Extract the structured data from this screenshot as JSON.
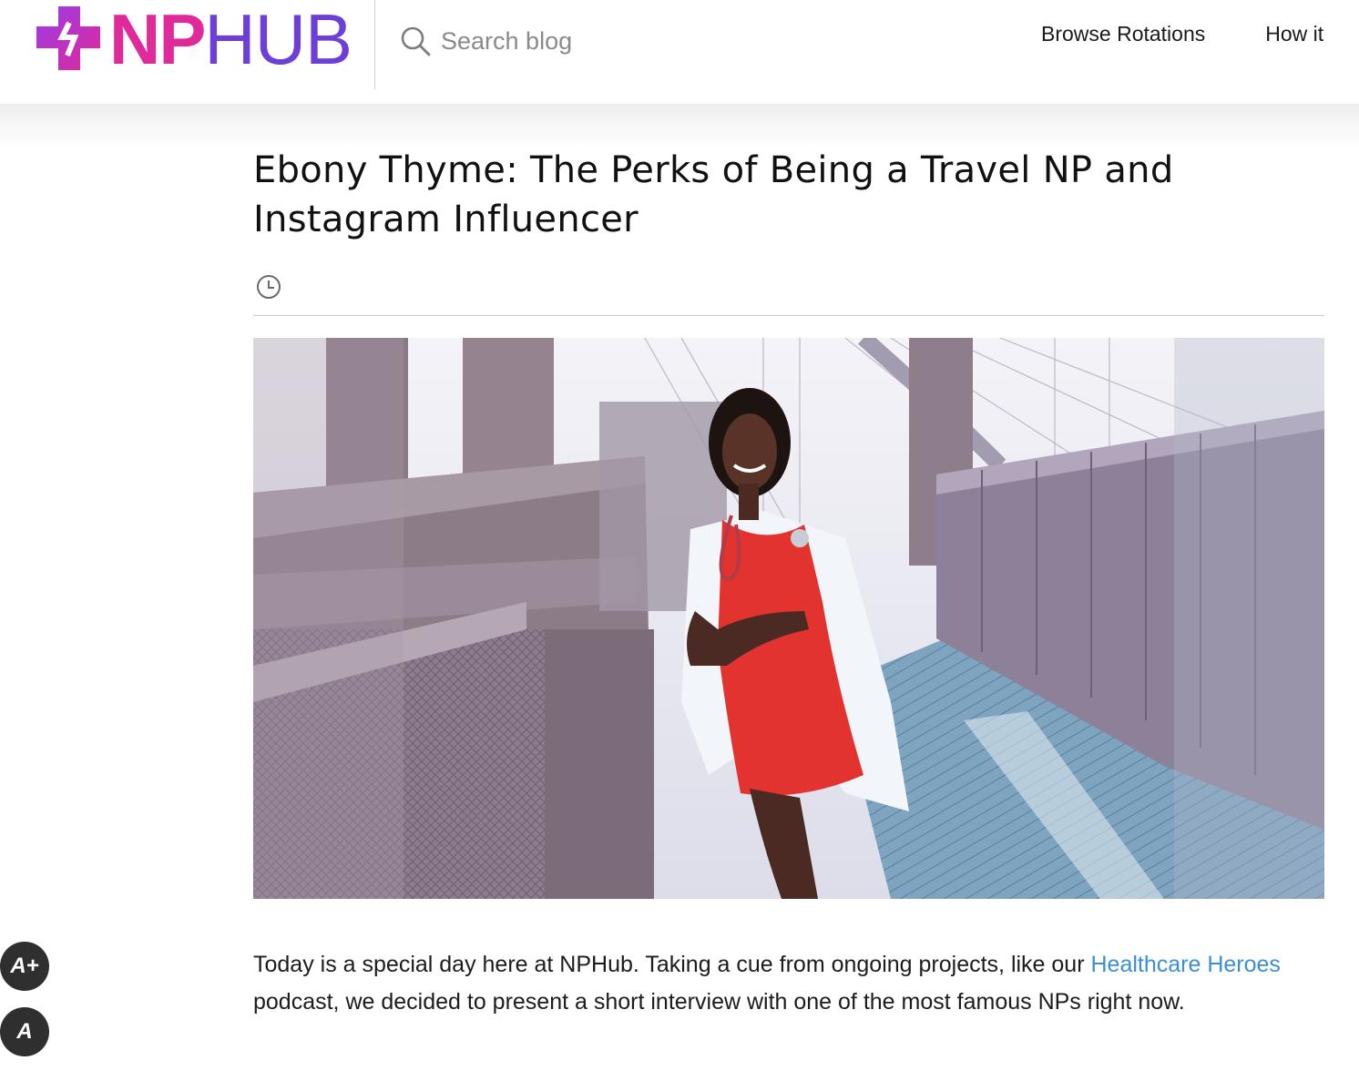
{
  "header": {
    "logo": {
      "np": "NP",
      "hub": "HUB"
    },
    "search": {
      "placeholder": "Search blog",
      "icon": "search-icon"
    },
    "nav": [
      {
        "label": "Browse Rotations"
      },
      {
        "label": "How it"
      }
    ]
  },
  "article": {
    "title": "Ebony Thyme: The Perks of Being a Travel NP and Instagram Influencer",
    "meta_icon": "clock-icon",
    "body": {
      "p1_before_link": "Today is a special day here at NPHub. Taking a cue from ongoing projects, like our ",
      "p1_link": "Healthcare Heroes",
      "p1_after_link": " podcast, we decided to present a short interview with one of the most famous NPs right now."
    }
  },
  "font_controls": {
    "increase_label": "A+",
    "normal_label": "A"
  },
  "colors": {
    "brand_pink": "#e0299a",
    "brand_purple": "#6b3fd8",
    "link_blue": "#3a8fd6",
    "button_dark": "#2f2f2f"
  }
}
